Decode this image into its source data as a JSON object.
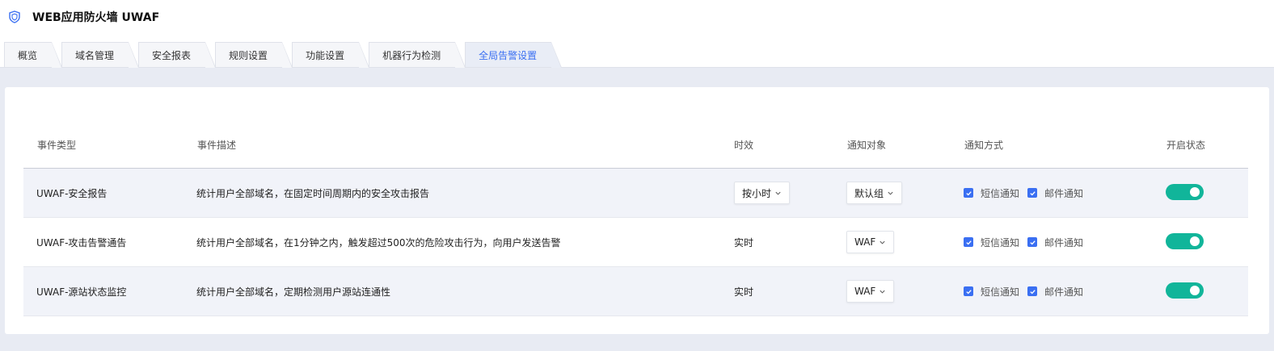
{
  "app": {
    "title": "WEB应用防火墙 UWAF",
    "logo_icon": "shield-icon"
  },
  "tabs": [
    {
      "label": "概览",
      "active": false
    },
    {
      "label": "域名管理",
      "active": false
    },
    {
      "label": "安全报表",
      "active": false
    },
    {
      "label": "规则设置",
      "active": false
    },
    {
      "label": "功能设置",
      "active": false
    },
    {
      "label": "机器行为检测",
      "active": false
    },
    {
      "label": "全局告警设置",
      "active": true
    }
  ],
  "table": {
    "headers": [
      "事件类型",
      "事件描述",
      "时效",
      "通知对象",
      "通知方式",
      "开启状态"
    ],
    "rows": [
      {
        "type": "UWAF-安全报告",
        "description": "统计用户全部域名，在固定时间周期内的安全攻击报告",
        "timeliness": "按小时",
        "timeliness_is_select": true,
        "target": "默认组",
        "sms": "短信通知",
        "email": "邮件通知",
        "sms_checked": true,
        "email_checked": true,
        "enabled": true
      },
      {
        "type": "UWAF-攻击告警通告",
        "description": "统计用户全部域名，在1分钟之内，触发超过500次的危险攻击行为，向用户发送告警",
        "timeliness": "实时",
        "timeliness_is_select": false,
        "target": "WAF",
        "sms": "短信通知",
        "email": "邮件通知",
        "sms_checked": true,
        "email_checked": true,
        "enabled": true
      },
      {
        "type": "UWAF-源站状态监控",
        "description": "统计用户全部域名，定期检测用户源站连通性",
        "timeliness": "实时",
        "timeliness_is_select": false,
        "target": "WAF",
        "sms": "短信通知",
        "email": "邮件通知",
        "sms_checked": true,
        "email_checked": true,
        "enabled": true
      }
    ]
  },
  "colors": {
    "accent": "#3a6ff2",
    "toggle_on": "#11b59a",
    "page_bg": "#e8ebf3"
  }
}
